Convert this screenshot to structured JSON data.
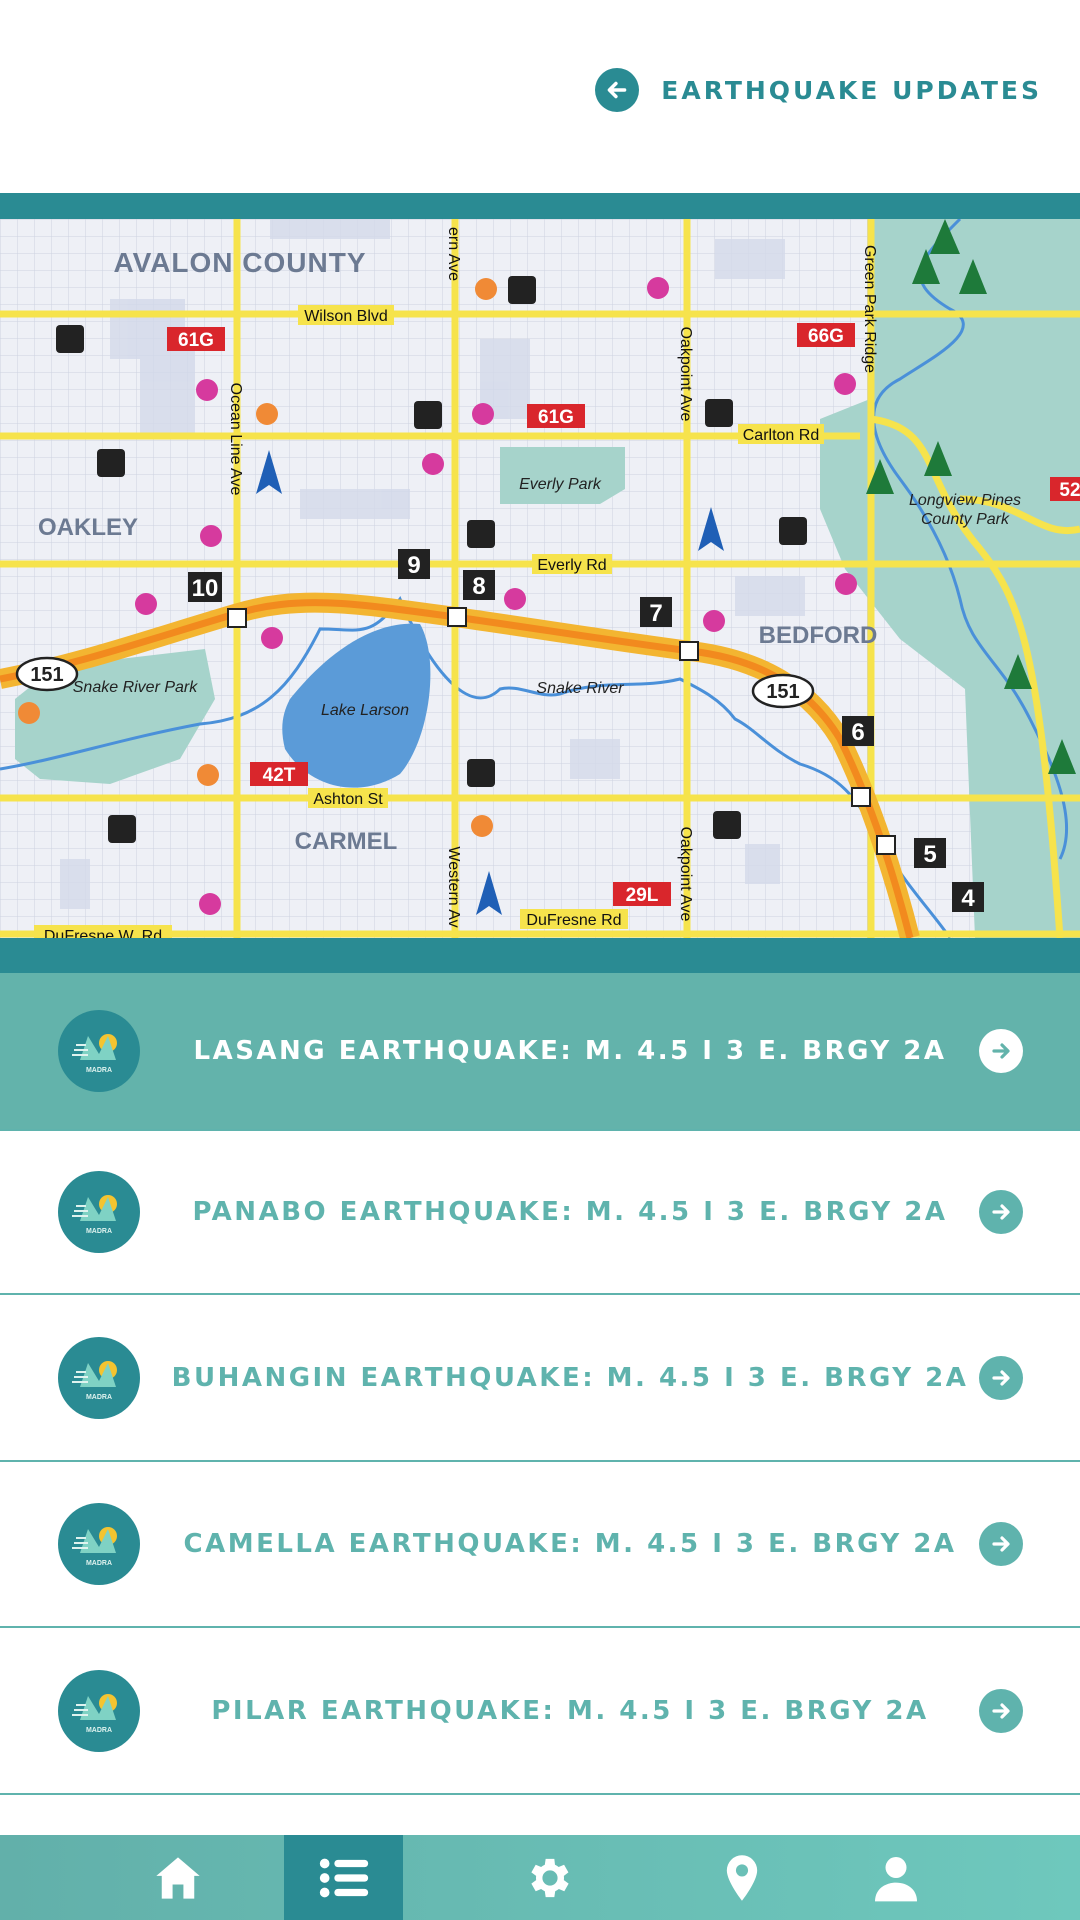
{
  "header": {
    "title": "EARTHQUAKE UPDATES",
    "back_icon": "arrow-left-icon"
  },
  "map": {
    "labels": {
      "avalon_county": "AVALON COUNTY",
      "oakley": "OAKLEY",
      "bedford": "BEDFORD",
      "carmel": "CARMEL",
      "wilson": "Wilson Blvd",
      "carlton": "Carlton Rd",
      "everly_rd": "Everly Rd",
      "ashton": "Ashton St",
      "dufresne_w": "DuFresne W. Rd",
      "dufresne": "DuFresne Rd",
      "ocean_line": "Ocean Line Ave",
      "western_top": "ern Ave",
      "western_bot": "Western Av",
      "oakpoint_top": "Oakpoint Ave",
      "oakpoint_bot": "Oakpoint Ave",
      "green_park": "Green Park Ridge",
      "everly_park": "Everly Park",
      "longview_1": "Longview Pines",
      "longview_2": "County Park",
      "snake_park": "Snake River Park",
      "snake_river": "Snake River",
      "lake": "Lake Larson",
      "hwy": "151",
      "route_61g_a": "61G",
      "route_61g_b": "61G",
      "route_66g": "66G",
      "route_42t": "42T",
      "route_29l": "29L",
      "route_52": "52",
      "exit_4": "4",
      "exit_5": "5",
      "exit_6": "6",
      "exit_7": "7",
      "exit_8": "8",
      "exit_9": "9",
      "exit_10": "10"
    }
  },
  "updates": [
    {
      "label": "LASANG EARTHQUAKE: M. 4.5 I 3 E. BRGY 2A",
      "logo_text": "MADRA"
    },
    {
      "label": "PANABO EARTHQUAKE: M. 4.5 I 3 E. BRGY 2A",
      "logo_text": "MADRA"
    },
    {
      "label": "BUHANGIN EARTHQUAKE: M. 4.5 I 3 E. BRGY 2A",
      "logo_text": "MADRA"
    },
    {
      "label": "CAMELLA EARTHQUAKE: M. 4.5 I 3 E. BRGY 2A",
      "logo_text": "MADRA"
    },
    {
      "label": "PILAR EARTHQUAKE: M. 4.5 I 3 E. BRGY 2A",
      "logo_text": "MADRA"
    }
  ],
  "nav": {
    "items": [
      "home-icon",
      "list-icon",
      "gear-icon",
      "location-pin-icon",
      "user-icon"
    ],
    "active": "list-icon"
  },
  "colors": {
    "teal_dark": "#2a8b93",
    "teal_light": "#5fb3ad",
    "active_row": "#63b3ab"
  }
}
